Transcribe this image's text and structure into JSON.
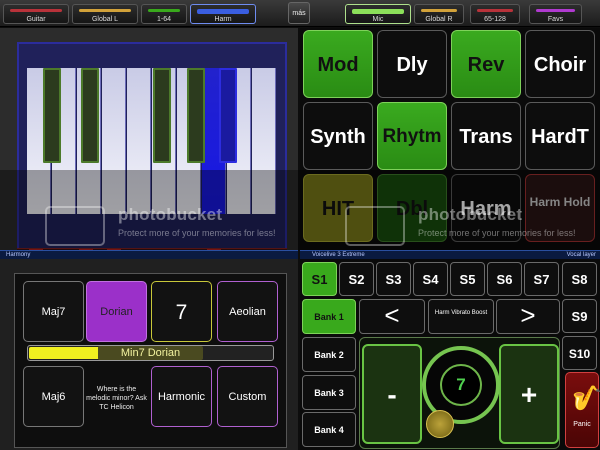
{
  "topbar": {
    "tabs": [
      {
        "label": "Guitar",
        "color": "#b8323a"
      },
      {
        "label": "Global L",
        "color": "#d2a23a"
      },
      {
        "label": "1-64",
        "color": "#39a91c"
      },
      {
        "label": "Harm",
        "color": "#3a5ee0"
      },
      {
        "label": "Mic",
        "color": "#8ce05a"
      },
      {
        "label": "Global R",
        "color": "#d2a23a"
      },
      {
        "label": "65-128",
        "color": "#b8323a"
      },
      {
        "label": "Favs",
        "color": "#b03ad0"
      }
    ],
    "mas": "más"
  },
  "keyboard": {
    "position_label": "A",
    "active_white_key_index": 7,
    "active_black_key_index": 4
  },
  "fx": [
    {
      "label": "Mod",
      "state": "green"
    },
    {
      "label": "Dly",
      "state": "off"
    },
    {
      "label": "Rev",
      "state": "green"
    },
    {
      "label": "Choir",
      "state": "off"
    },
    {
      "label": "Synth",
      "state": "off"
    },
    {
      "label": "Rhytm",
      "state": "green"
    },
    {
      "label": "Trans",
      "state": "off"
    },
    {
      "label": "HardT",
      "state": "off"
    },
    {
      "label": "HIT",
      "state": "yellow"
    },
    {
      "label": "Dbl",
      "state": "dimgreen"
    },
    {
      "label": "Harm",
      "state": "off"
    },
    {
      "label": "Harm Hold",
      "state": "red"
    }
  ],
  "strips": {
    "harmony": "Harmony",
    "center": "Voicelive 3 Extreme",
    "right": "Vocal layer"
  },
  "harmony": {
    "buttons": [
      "Maj7",
      "Dorian",
      "7",
      "Aeolian",
      "Maj6",
      "Where is the melodic minor? Ask TC Helicon",
      "Harmonic",
      "Custom"
    ],
    "slider_label": "Min7 Dorian",
    "slider_level": 0.7
  },
  "voicelive": {
    "steps": [
      "S1",
      "S2",
      "S3",
      "S4",
      "S5",
      "S6",
      "S7",
      "S8",
      "S9",
      "S10"
    ],
    "banks": [
      "Bank 1",
      "Bank 2",
      "Bank 3",
      "Bank 4"
    ],
    "prev": "<",
    "next": ">",
    "boost": "Harm Vibrato Boost",
    "minus": "-",
    "plus": "+",
    "dial_value": "7",
    "panic": "Panic"
  },
  "watermark": {
    "brand": "photobucket",
    "tagline": "Protect more of your memories for less!"
  },
  "colors": {
    "green": "#39a91c",
    "purple": "#9b30c9",
    "yellow": "#f0f020",
    "blue": "#2222cc"
  }
}
